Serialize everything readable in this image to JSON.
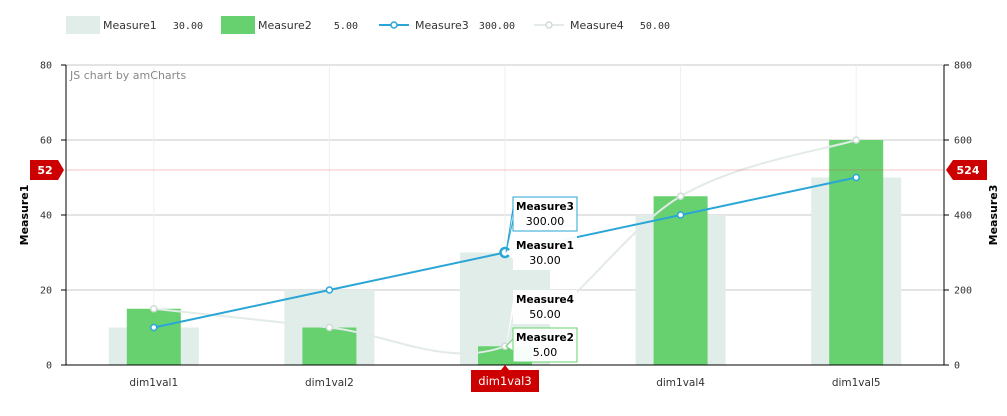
{
  "chart_data": {
    "type": "bar",
    "credit": "JS chart by amCharts",
    "categories": [
      "dim1val1",
      "dim1val2",
      "dim1val3",
      "dim1val4",
      "dim1val5"
    ],
    "left_axis": {
      "title": "Measure1",
      "range": [
        0,
        80
      ],
      "ticks": [
        "0",
        "20",
        "40",
        "60",
        "80"
      ]
    },
    "right_axis": {
      "title": "Measure3",
      "range": [
        0,
        800
      ],
      "ticks": [
        "0",
        "200",
        "400",
        "600",
        "800"
      ]
    },
    "series": [
      {
        "name": "Measure1",
        "type": "column",
        "axis": "left",
        "color": "#e0ede9",
        "values": [
          10,
          20,
          30,
          40,
          50
        ]
      },
      {
        "name": "Measure2",
        "type": "column",
        "axis": "left",
        "color": "#67d16f",
        "values": [
          15,
          10,
          5,
          45,
          60
        ]
      },
      {
        "name": "Measure3",
        "type": "line",
        "axis": "right",
        "color": "#2aa6d6",
        "values": [
          100,
          200,
          300,
          400,
          500
        ]
      },
      {
        "name": "Measure4",
        "type": "smoothed-line",
        "axis": "left",
        "color": "#e2ebe8",
        "values": [
          15,
          10,
          5,
          45,
          60
        ]
      }
    ],
    "legend": {
      "position": "top",
      "items": [
        {
          "label": "Measure1",
          "value": "30.00"
        },
        {
          "label": "Measure2",
          "value": "5.00"
        },
        {
          "label": "Measure3",
          "value": "300.00"
        },
        {
          "label": "Measure4",
          "value": "50.00"
        }
      ]
    },
    "cursor": {
      "category": "dim1val3",
      "left_value": 52,
      "left_label": "52",
      "right_value": 524,
      "right_label": "524",
      "color": "#cc0000"
    },
    "balloons": [
      {
        "series": "Measure3",
        "title": "Measure3",
        "value": "300.00"
      },
      {
        "series": "Measure1",
        "title": "Measure1",
        "value": "30.00"
      },
      {
        "series": "Measure4",
        "title": "Measure4",
        "value": "50.00"
      },
      {
        "series": "Measure2",
        "title": "Measure2",
        "value": "5.00"
      }
    ],
    "grid": true
  }
}
